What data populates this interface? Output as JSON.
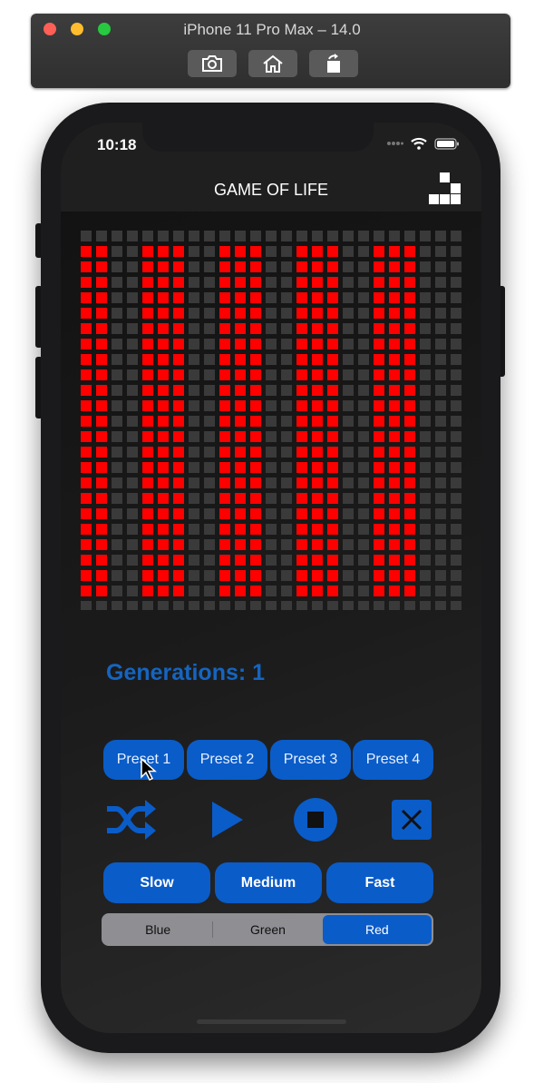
{
  "simulator": {
    "title": "iPhone 11 Pro Max – 14.0",
    "buttons": [
      "screenshot-icon",
      "home-icon",
      "rotate-icon"
    ]
  },
  "status_bar": {
    "time": "10:18"
  },
  "nav": {
    "title": "GAME OF LIFE",
    "icon": "grid-blocks-icon"
  },
  "board": {
    "cols": 25,
    "rows": 25,
    "live_color": "#ff0000",
    "dead_color": "#3a3a3a",
    "live_columns": [
      0,
      1,
      4,
      5,
      6,
      9,
      10,
      11,
      14,
      15,
      16,
      19,
      20,
      21
    ],
    "live_rows_from": 1,
    "live_rows_to": 23
  },
  "generations_label": "Generations: 1",
  "presets": [
    "Preset 1",
    "Preset 2",
    "Preset 3",
    "Preset 4"
  ],
  "controls": [
    "shuffle-icon",
    "play-icon",
    "stop-icon",
    "clear-icon"
  ],
  "speeds": [
    "Slow",
    "Medium",
    "Fast"
  ],
  "color_options": [
    "Blue",
    "Green",
    "Red"
  ],
  "selected_color": "Red",
  "accent": "#0a5cc8"
}
